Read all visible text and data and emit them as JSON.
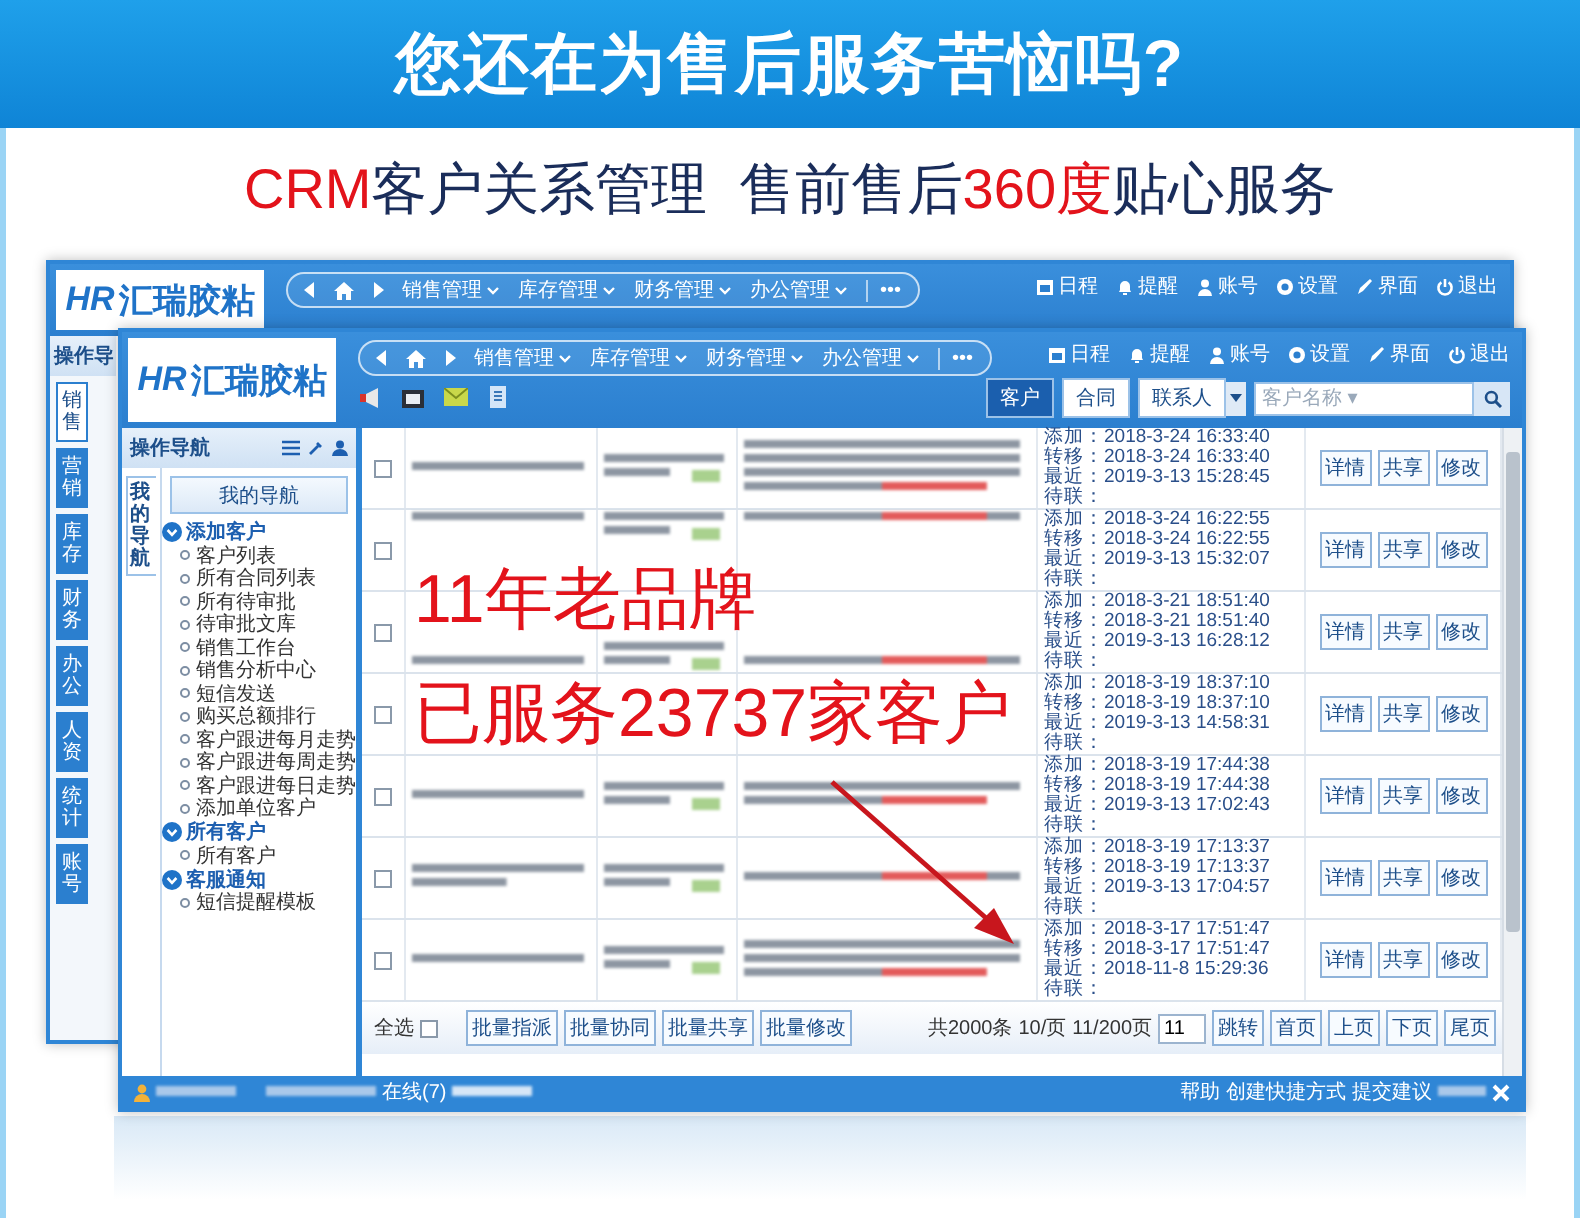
{
  "banner": {
    "title": "您还在为售后服务苦恼吗?",
    "subtitle": [
      {
        "text": "CRM",
        "kind": "accent"
      },
      {
        "text": "客户关系管理  售前售后",
        "kind": "plain"
      },
      {
        "text": "360度",
        "kind": "accent"
      },
      {
        "text": "贴心服务",
        "kind": "plain"
      }
    ]
  },
  "back_window": {
    "logo": {
      "mark": "HR",
      "name": "汇瑞胶粘"
    },
    "nav": {
      "items": [
        "销售管理",
        "库存管理",
        "财务管理",
        "办公管理"
      ],
      "more": "•••"
    },
    "top_links": [
      "日程",
      "提醒",
      "账号",
      "设置",
      "界面",
      "退出"
    ],
    "sidebar_title": "操作导",
    "module_tabs": [
      {
        "label": "销售",
        "selected": true
      },
      {
        "label": "营销",
        "selected": false
      },
      {
        "label": "库存",
        "selected": false
      },
      {
        "label": "财务",
        "selected": false
      },
      {
        "label": "办公",
        "selected": false
      },
      {
        "label": "人资",
        "selected": false
      },
      {
        "label": "统计",
        "selected": false
      },
      {
        "label": "账号",
        "selected": false
      }
    ]
  },
  "window": {
    "logo": {
      "mark": "HR",
      "name": "汇瑞胶粘"
    },
    "nav": {
      "items": [
        "销售管理",
        "库存管理",
        "财务管理",
        "办公管理"
      ],
      "more": "•••"
    },
    "top_links": [
      "日程",
      "提醒",
      "账号",
      "设置",
      "界面",
      "退出"
    ],
    "search_scope": [
      {
        "label": "客户",
        "selected": true
      },
      {
        "label": "合同",
        "selected": false
      },
      {
        "label": "联系人",
        "selected": false
      }
    ],
    "search": {
      "placeholder": "客户名称 ▾"
    },
    "sidebar": {
      "title": "操作导航",
      "tab": "我的导航",
      "button": "我的导航",
      "tree": [
        {
          "label": "添加客户",
          "expanded": true,
          "children": [
            {
              "label": "客户列表"
            },
            {
              "label": "所有合同列表"
            },
            {
              "label": "所有待审批"
            },
            {
              "label": "待审批文库"
            },
            {
              "label": "销售工作台"
            },
            {
              "label": "销售分析中心"
            },
            {
              "label": "短信发送"
            },
            {
              "label": "购买总额排行"
            },
            {
              "label": "客户跟进每月走势"
            },
            {
              "label": "客户跟进每周走势"
            },
            {
              "label": "客户跟进每日走势"
            },
            {
              "label": "添加单位客户"
            }
          ]
        },
        {
          "label": "所有客户",
          "expanded": true,
          "children": [
            {
              "label": "所有客户"
            }
          ]
        },
        {
          "label": "客服通知",
          "expanded": true,
          "children": [
            {
              "label": "短信提醒模板"
            }
          ]
        }
      ]
    },
    "rows": [
      {
        "checked": false,
        "dates": [
          "添加：2018-3-24 16:33:40",
          "转移：2018-3-24 16:33:40",
          "最近：2019-3-13 15:28:45",
          "待联："
        ],
        "actions": [
          "详情",
          "共享",
          "修改"
        ]
      },
      {
        "checked": false,
        "dates": [
          "添加：2018-3-24 16:22:55",
          "转移：2018-3-24 16:22:55",
          "最近：2019-3-13 15:32:07",
          "待联："
        ],
        "actions": [
          "详情",
          "共享",
          "修改"
        ]
      },
      {
        "checked": false,
        "dates": [
          "添加：2018-3-21 18:51:40",
          "转移：2018-3-21 18:51:40",
          "最近：2019-3-13 16:28:12",
          "待联："
        ],
        "actions": [
          "详情",
          "共享",
          "修改"
        ]
      },
      {
        "checked": false,
        "dates": [
          "添加：2018-3-19 18:37:10",
          "转移：2018-3-19 18:37:10",
          "最近：2019-3-13 14:58:31",
          "待联："
        ],
        "actions": [
          "详情",
          "共享",
          "修改"
        ]
      },
      {
        "checked": false,
        "dates": [
          "添加：2018-3-19 17:44:38",
          "转移：2018-3-19 17:44:38",
          "最近：2019-3-13 17:02:43",
          "待联："
        ],
        "actions": [
          "详情",
          "共享",
          "修改"
        ]
      },
      {
        "checked": false,
        "dates": [
          "添加：2018-3-19 17:13:37",
          "转移：2018-3-19 17:13:37",
          "最近：2019-3-13 17:04:57",
          "待联："
        ],
        "actions": [
          "详情",
          "共享",
          "修改"
        ]
      },
      {
        "checked": false,
        "dates": [
          "添加：2018-3-17 17:51:47",
          "转移：2018-3-17 17:51:47",
          "最近：2018-11-8 15:29:36",
          "待联："
        ],
        "actions": [
          "详情",
          "共享",
          "修改"
        ]
      }
    ],
    "footer": {
      "select_all": {
        "label": "全选",
        "checked": false
      },
      "bulk_actions": [
        "批量指派",
        "批量协同",
        "批量共享",
        "批量修改"
      ],
      "pager": {
        "total": "共2000条",
        "per_page": "10/页",
        "page": "11/200页",
        "page_input": "11",
        "buttons": [
          "跳转",
          "首页",
          "上页",
          "下页",
          "尾页"
        ]
      }
    },
    "status_bar": {
      "online": "在线(7)",
      "links": [
        "帮助",
        "创建快捷方式",
        "提交建议"
      ]
    }
  },
  "overlay": {
    "lines": [
      "11年老品牌",
      "已服务23737家客户"
    ]
  }
}
